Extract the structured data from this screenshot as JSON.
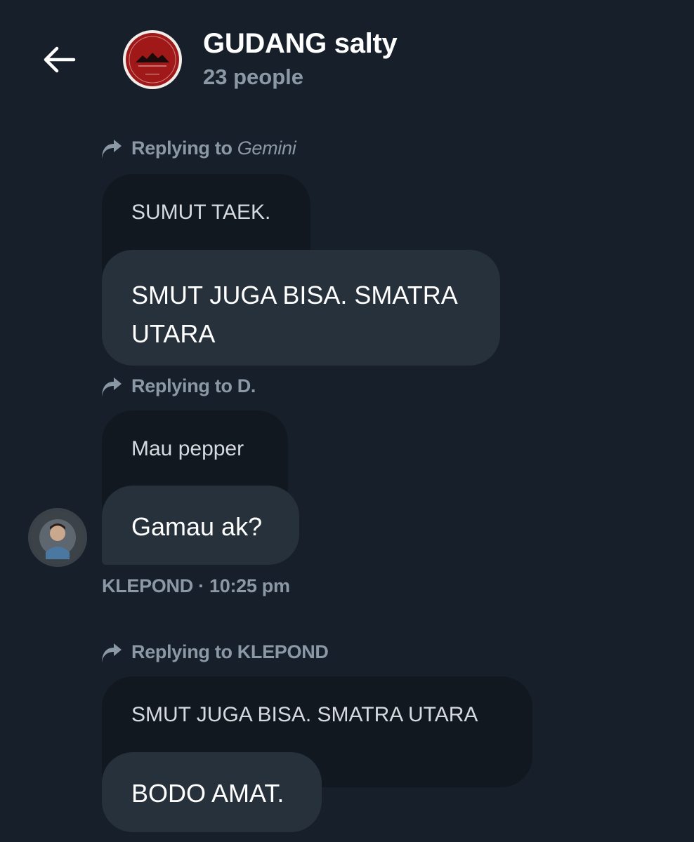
{
  "header": {
    "back_icon": "arrow-left-icon",
    "title": "GUDANG salty",
    "subtitle": "23 people",
    "avatar_color": "#a11818"
  },
  "messages": [
    {
      "reply_prefix": "Replying to",
      "reply_to": "Gemini",
      "quoted_text": "SUMUT TAEK.",
      "text_line1": "SMUT JUGA BISA. SMATRA",
      "text_line2": "UTARA"
    },
    {
      "reply_prefix": "Replying to",
      "reply_to": "D.",
      "quoted_text": "Mau pepper",
      "text": "Gamau ak?",
      "sender": "KLEPOND",
      "separator": "·",
      "time": "10:25 pm"
    },
    {
      "reply_prefix": "Replying to",
      "reply_to": "KLEPOND",
      "quoted_text": "SMUT JUGA BISA. SMATRA UTARA",
      "text": "BODO AMAT."
    }
  ],
  "colors": {
    "background": "#17202a",
    "bubble": "#27313c",
    "quoted_bubble": "#111820",
    "muted_text": "#8b98a5"
  }
}
